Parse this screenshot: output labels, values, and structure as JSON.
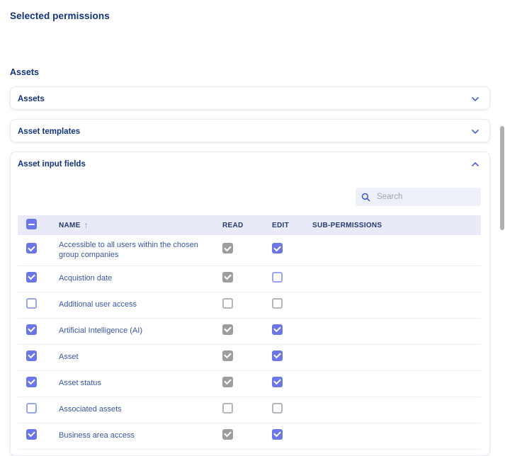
{
  "page": {
    "title": "Selected permissions"
  },
  "section": {
    "title": "Assets"
  },
  "accordions": [
    {
      "label": "Assets",
      "state": "collapsed"
    },
    {
      "label": "Asset templates",
      "state": "collapsed"
    },
    {
      "label": "Asset input fields",
      "state": "expanded"
    }
  ],
  "panel": {
    "search": {
      "placeholder": "Search",
      "value": ""
    },
    "table": {
      "columns": {
        "name": "NAME",
        "read": "READ",
        "edit": "EDIT",
        "sub": "SUB-PERMISSIONS"
      },
      "sort": {
        "column": "NAME",
        "direction": "asc"
      },
      "select_all_state": "indeterminate",
      "rows": [
        {
          "name": "Accessible to all users within the chosen group companies",
          "selected": true,
          "read": "checked-disabled",
          "edit": "checked"
        },
        {
          "name": "Acquistion date",
          "selected": true,
          "read": "checked-disabled",
          "edit": "unchecked"
        },
        {
          "name": "Additional user access",
          "selected": false,
          "read": "unchecked-disabled",
          "edit": "unchecked-disabled"
        },
        {
          "name": "Artificial Intelligence (AI)",
          "selected": true,
          "read": "checked-disabled",
          "edit": "checked"
        },
        {
          "name": "Asset",
          "selected": true,
          "read": "checked-disabled",
          "edit": "checked"
        },
        {
          "name": "Asset status",
          "selected": true,
          "read": "checked-disabled",
          "edit": "checked"
        },
        {
          "name": "Associated assets",
          "selected": false,
          "read": "unchecked-disabled",
          "edit": "unchecked-disabled"
        },
        {
          "name": "Business area access",
          "selected": true,
          "read": "checked-disabled",
          "edit": "checked"
        }
      ]
    }
  },
  "icons": {
    "sort_asc": "↑"
  },
  "colors": {
    "heading": "#13327E",
    "row_text": "#3A55A4",
    "accent_indigo": "#6B76E8",
    "disabled_gray": "#9C9CA1",
    "table_header_bg": "#E8EBF7",
    "search_bg": "#EEF0F8",
    "scrollbar": "#AFAFB2"
  }
}
